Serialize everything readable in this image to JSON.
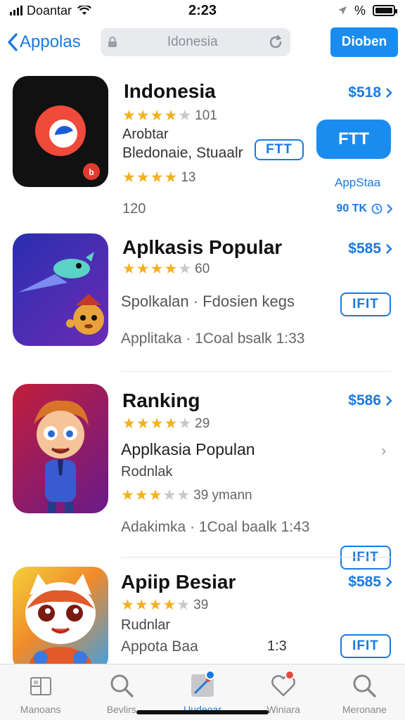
{
  "status_bar": {
    "carrier": "Doantar",
    "time": "2:23",
    "battery_level": "%",
    "icons": [
      "signal-icon",
      "wifi-icon",
      "location-icon",
      "battery-icon"
    ]
  },
  "nav": {
    "back_label": "Appolas",
    "search_placeholder": "Idonesia",
    "action_label": "Dioben"
  },
  "apps": [
    {
      "title": "Indonesia",
      "rating": 4,
      "rating_count": "101",
      "line1": "Arobtar",
      "line2": "Bledonaie, Stuaalr",
      "small_button": "FTT",
      "rating2": 4,
      "rating2_count": "13",
      "line3": "120",
      "price": "$518",
      "big_button": "FTT",
      "side_label": "AppStaa",
      "side_meta": "90 TK"
    },
    {
      "title": "Aplkasis Popular",
      "rating": 4,
      "rating_count": "60",
      "line1": "Spolkalan · Fdosien kegs",
      "line2": "Applitaka · 1Coal bsalk 1:33",
      "price": "$585",
      "button": "IFIT"
    },
    {
      "title": "Ranking",
      "rating": 4,
      "rating_count": "29",
      "line1": "Applkasia Populan",
      "line2": "Rodnlak",
      "rating2": 3,
      "rating2_count": "39 ymann",
      "line3": "Adakimka · 1Coal baalk 1:43",
      "price": "$586",
      "button": "IFIT"
    },
    {
      "title": "Apiip Besiar",
      "rating": 4,
      "rating_count": "39",
      "line1": "Rudnlar",
      "line2": "Appota Baa",
      "line2_right": "1:3",
      "price": "$585",
      "button": "IFIT"
    }
  ],
  "tabs": [
    {
      "label": "Manoans",
      "icon": "today-icon"
    },
    {
      "label": "Bevlirs",
      "icon": "search-icon"
    },
    {
      "label": "Uudeoar",
      "icon": "apps-icon"
    },
    {
      "label": "Winiara",
      "icon": "heart-icon"
    },
    {
      "label": "Meronane",
      "icon": "search-icon"
    }
  ],
  "colors": {
    "accent": "#1a7ae0",
    "accent_fill": "#1a8cf0",
    "star": "#f3b11e",
    "badge_red": "#e64a3a"
  }
}
